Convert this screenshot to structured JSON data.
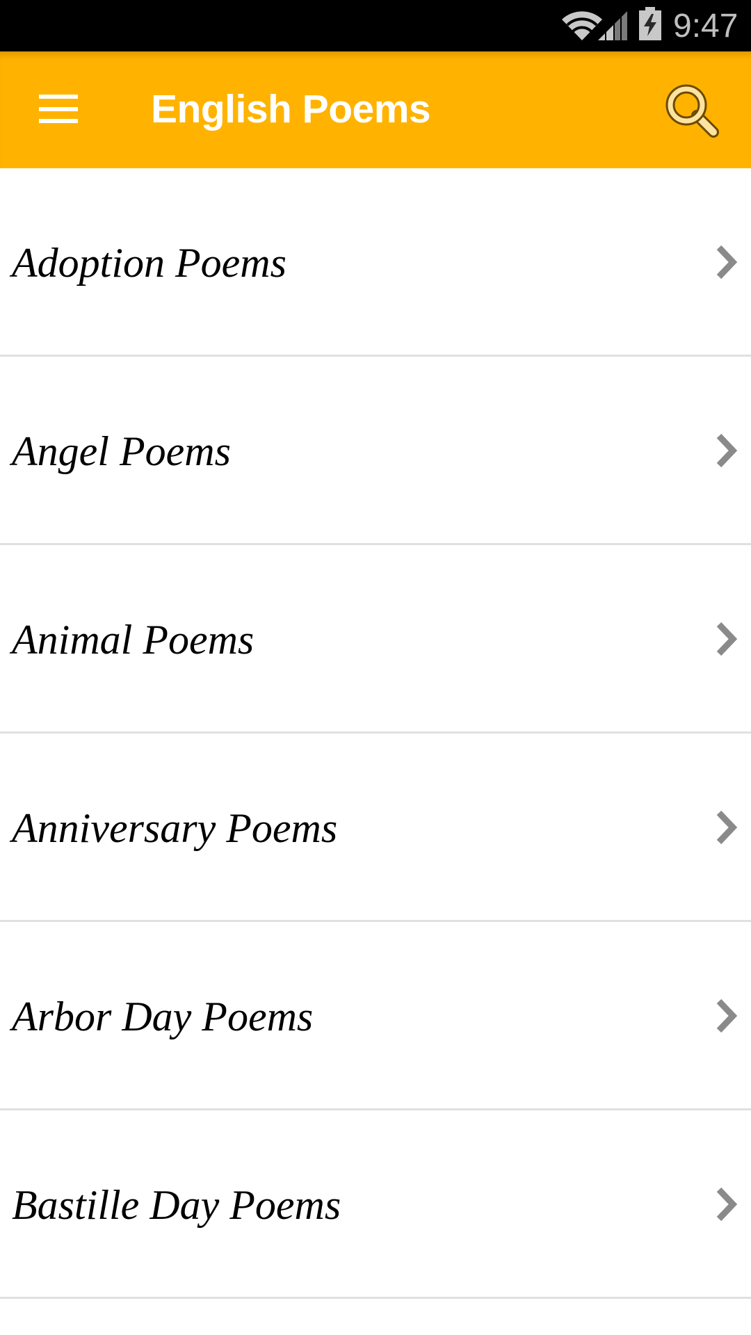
{
  "status_bar": {
    "time": "9:47",
    "icons": [
      "wifi-icon",
      "signal-icon",
      "battery-charging-icon"
    ]
  },
  "toolbar": {
    "title": "English Poems",
    "menu_icon": "hamburger-menu-icon",
    "search_icon": "search-icon",
    "background_color": "#FFB300"
  },
  "list": {
    "items": [
      {
        "label": "Adoption Poems"
      },
      {
        "label": "Angel Poems"
      },
      {
        "label": "Animal Poems"
      },
      {
        "label": "Anniversary Poems"
      },
      {
        "label": "Arbor Day Poems"
      },
      {
        "label": "Bastille Day Poems"
      }
    ],
    "trailing_icon": "chevron-right-icon"
  }
}
